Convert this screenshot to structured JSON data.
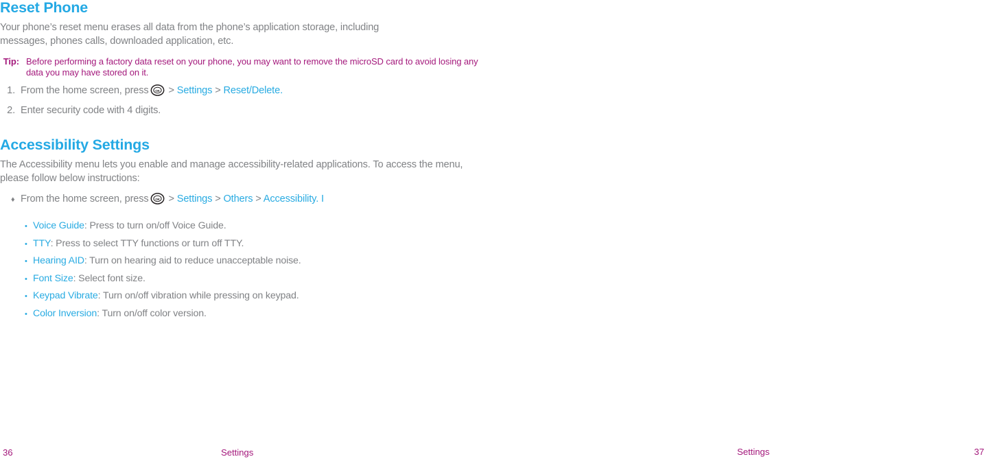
{
  "document": {
    "type": "user-manual-page-spread",
    "colors": {
      "heading_blue": "#24a9e4",
      "link_blue": "#29abe2",
      "body_gray": "#808285",
      "tip_magenta": "#a4197c",
      "background": "#ffffff"
    }
  },
  "reset_phone": {
    "heading": "Reset Phone",
    "intro": "Your phone’s reset menu erases all data from the phone’s application storage, including messages, phones calls, downloaded application, etc.",
    "tip": {
      "label": "Tip:",
      "text": "Before performing a factory data reset on your phone, you may want to remove the microSD card to avoid losing any data you may have stored on it."
    },
    "steps": [
      {
        "number": "1.",
        "prefix": "From the home screen, press",
        "icon": "ok-key-icon",
        "path": [
          {
            "sep": ">",
            "label": "Settings"
          },
          {
            "sep": ">",
            "label": "Reset/Delete"
          }
        ],
        "suffix": "."
      },
      {
        "number": "2.",
        "prefix": "Enter security code with 4 digits.",
        "icon": null,
        "path": [],
        "suffix": ""
      }
    ]
  },
  "accessibility_settings": {
    "heading": "Accessibility Settings",
    "intro": "The Accessibility menu lets you enable and manage accessibility-related applications. To access the menu, please follow below instructions:",
    "diamond_step": {
      "bullet": "♦",
      "prefix": "From the home screen, press",
      "icon": "ok-key-icon",
      "path": [
        {
          "sep": ">",
          "label": "Settings"
        },
        {
          "sep": ">",
          "label": "Others"
        },
        {
          "sep": ">",
          "label": "Accessibility"
        }
      ],
      "suffix": ". I"
    },
    "options": [
      {
        "bullet": "•",
        "term": "Voice Guide",
        "desc": ": Press to turn on/off Voice Guide."
      },
      {
        "bullet": "•",
        "term": "TTY",
        "desc": ": Press to select TTY functions or turn off TTY."
      },
      {
        "bullet": "•",
        "term": "Hearing AID",
        "desc": ": Turn on hearing aid to reduce unacceptable noise."
      },
      {
        "bullet": "•",
        "term": "Font Size",
        "desc": ": Select font size."
      },
      {
        "bullet": "•",
        "term": "Keypad Vibrate",
        "desc": ": Turn on/off vibration while pressing on keypad."
      },
      {
        "bullet": "•",
        "term": "Color Inversion",
        "desc": ": Turn on/off color version."
      }
    ]
  },
  "icons": {
    "ok_key": {
      "name": "ok-key-icon",
      "label": "OK"
    }
  },
  "footer_left": {
    "page_number": "36",
    "section_label": "Settings"
  },
  "footer_right": {
    "page_number": "37",
    "section_label": "Settings"
  }
}
